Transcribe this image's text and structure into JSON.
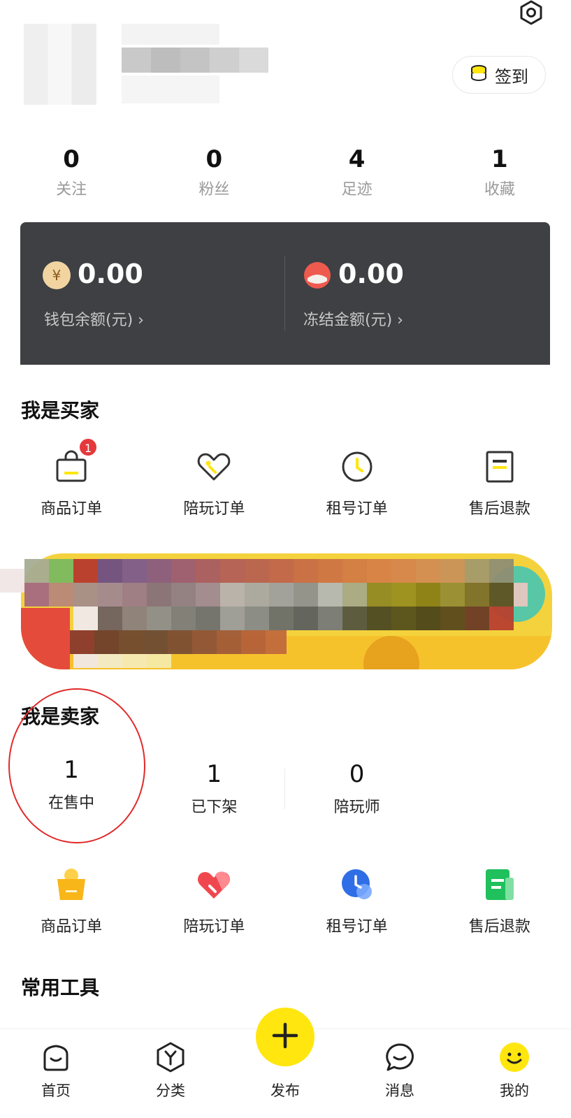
{
  "header": {
    "checkin_label": "签到"
  },
  "stats": [
    {
      "value": "0",
      "label": "关注"
    },
    {
      "value": "0",
      "label": "粉丝"
    },
    {
      "value": "4",
      "label": "足迹"
    },
    {
      "value": "1",
      "label": "收藏"
    }
  ],
  "wallet": {
    "balance": {
      "amount": "0.00",
      "label": "钱包余额(元)",
      "chevron": "›"
    },
    "frozen": {
      "amount": "0.00",
      "label": "冻结金额(元)",
      "chevron": "›"
    }
  },
  "buyer": {
    "title": "我是买家",
    "items": [
      {
        "label": "商品订单",
        "icon": "shopping-bag-icon",
        "badge": "1"
      },
      {
        "label": "陪玩订单",
        "icon": "heart-tag-icon"
      },
      {
        "label": "租号订单",
        "icon": "clock-icon"
      },
      {
        "label": "售后退款",
        "icon": "document-icon"
      }
    ]
  },
  "seller": {
    "title": "我是卖家",
    "stats": [
      {
        "value": "1",
        "label": "在售中"
      },
      {
        "value": "1",
        "label": "已下架"
      },
      {
        "value": "0",
        "label": "陪玩师"
      }
    ],
    "items": [
      {
        "label": "商品订单",
        "icon": "shopping-bag-icon"
      },
      {
        "label": "陪玩订单",
        "icon": "heart-tag-icon"
      },
      {
        "label": "租号订单",
        "icon": "clock-icon"
      },
      {
        "label": "售后退款",
        "icon": "document-icon"
      }
    ]
  },
  "tools": {
    "title": "常用工具"
  },
  "nav": {
    "home": "首页",
    "category": "分类",
    "publish": "发布",
    "messages": "消息",
    "mine": "我的"
  },
  "colors": {
    "accent": "#ffe60f",
    "wallet_bg": "#3e4043",
    "badge": "#e5383b",
    "annotation_circle": "#e12a2a"
  }
}
